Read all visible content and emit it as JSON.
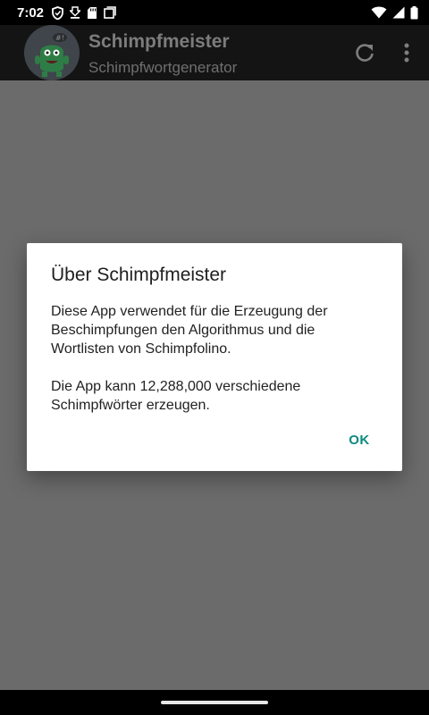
{
  "status_bar": {
    "time": "7:02",
    "left_icons": [
      "shield-icon",
      "download-icon",
      "sd-card-icon",
      "screenshot-icon"
    ],
    "right_icons": [
      "wifi-icon",
      "signal-icon",
      "battery-icon"
    ]
  },
  "app_bar": {
    "title": "Schimpfmeister",
    "subtitle": "Schimpfwortgenerator",
    "actions": [
      "refresh-icon",
      "more-vert-icon"
    ]
  },
  "dialog": {
    "title": "Über Schimpfmeister",
    "paragraph_1": "Diese App verwendet für die Erzeugung der Beschimpfungen den Algorithmus und die Wortlisten von Schimpfolino.",
    "paragraph_2": "Die App kann 12,288,000 verschiedene Schimpfwörter erzeugen.",
    "ok_label": "OK"
  },
  "colors": {
    "accent": "#0a8a80",
    "scrim": "#6b6b6b",
    "app_bar": "#141414"
  }
}
